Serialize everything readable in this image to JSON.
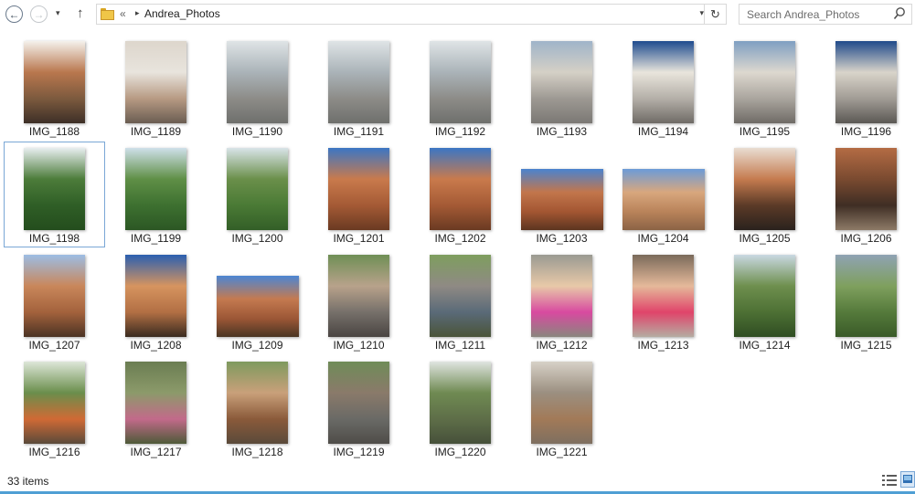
{
  "nav": {
    "back_glyph": "←",
    "forward_glyph": "→",
    "recent_glyph": "▾",
    "up_glyph": "↑"
  },
  "address": {
    "overflow_glyph": "«",
    "separator_glyph": "▸",
    "path": "Andrea_Photos",
    "dropdown_glyph": "▾",
    "refresh_glyph": "↻"
  },
  "search": {
    "placeholder": "Search Andrea_Photos"
  },
  "files": [
    {
      "name": "IMG_1188",
      "orientation": "portrait",
      "colors": [
        "#f4f1ec",
        "#b9774e",
        "#7c5a3e",
        "#3d2f27"
      ]
    },
    {
      "name": "IMG_1189",
      "orientation": "portrait",
      "colors": [
        "#ddd6cc",
        "#e8e4dd",
        "#b79a83",
        "#6a5d52"
      ]
    },
    {
      "name": "IMG_1190",
      "orientation": "portrait",
      "colors": [
        "#dfe4e6",
        "#aab3b8",
        "#8d8c88",
        "#6e6f6c"
      ]
    },
    {
      "name": "IMG_1191",
      "orientation": "portrait",
      "colors": [
        "#dfe4e6",
        "#aab3b8",
        "#8d8c88",
        "#6e6f6c"
      ]
    },
    {
      "name": "IMG_1192",
      "orientation": "portrait",
      "colors": [
        "#dfe4e6",
        "#aab3b8",
        "#8d8c88",
        "#6e6f6c"
      ]
    },
    {
      "name": "IMG_1193",
      "orientation": "portrait",
      "colors": [
        "#9fb4c9",
        "#d5d0c6",
        "#9d9993",
        "#7b7874"
      ]
    },
    {
      "name": "IMG_1194",
      "orientation": "portrait",
      "colors": [
        "#1e4b8f",
        "#e9e5dc",
        "#b4afa8",
        "#6f6b66"
      ]
    },
    {
      "name": "IMG_1195",
      "orientation": "portrait",
      "colors": [
        "#7f9fc2",
        "#ddd8cf",
        "#aaa59e",
        "#6f6b66"
      ]
    },
    {
      "name": "IMG_1196",
      "orientation": "portrait",
      "colors": [
        "#1f4a8a",
        "#d9d4ca",
        "#a19c95",
        "#5b5854"
      ]
    },
    {
      "name": "IMG_1198",
      "orientation": "portrait",
      "colors": [
        "#e8eef0",
        "#4c7c3a",
        "#2f5e26",
        "#244d1d"
      ]
    },
    {
      "name": "IMG_1199",
      "orientation": "portrait",
      "colors": [
        "#cfe0ea",
        "#5f8f46",
        "#3d7030",
        "#2c5724"
      ]
    },
    {
      "name": "IMG_1200",
      "orientation": "portrait",
      "colors": [
        "#d9e4e9",
        "#6a8f4a",
        "#4a7a35",
        "#335f27"
      ]
    },
    {
      "name": "IMG_1201",
      "orientation": "portrait",
      "colors": [
        "#3b76c4",
        "#c97a4c",
        "#a45a35",
        "#6a3a22"
      ]
    },
    {
      "name": "IMG_1202",
      "orientation": "portrait",
      "colors": [
        "#3b76c4",
        "#c97a4c",
        "#a45a35",
        "#6a3a22"
      ]
    },
    {
      "name": "IMG_1203",
      "orientation": "landscape",
      "colors": [
        "#4a83cf",
        "#c2764c",
        "#a35632",
        "#5c3520"
      ]
    },
    {
      "name": "IMG_1204",
      "orientation": "landscape",
      "colors": [
        "#6b9bd8",
        "#d8a77e",
        "#b9835a",
        "#8b6345"
      ]
    },
    {
      "name": "IMG_1205",
      "orientation": "portrait",
      "colors": [
        "#e9ddd2",
        "#c57b4f",
        "#5b3a27",
        "#2a221d"
      ]
    },
    {
      "name": "IMG_1206",
      "orientation": "portrait",
      "colors": [
        "#b46c44",
        "#7a4a30",
        "#3f2e24",
        "#8d7a67"
      ]
    },
    {
      "name": "IMG_1207",
      "orientation": "portrait",
      "colors": [
        "#9cbde4",
        "#c9875b",
        "#a3623c",
        "#4b3324"
      ]
    },
    {
      "name": "IMG_1208",
      "orientation": "portrait",
      "colors": [
        "#2a5fb0",
        "#d6945f",
        "#b26f44",
        "#3a2b20"
      ]
    },
    {
      "name": "IMG_1209",
      "orientation": "landscape",
      "colors": [
        "#4c86d3",
        "#c47a50",
        "#9c5736",
        "#4a3523"
      ]
    },
    {
      "name": "IMG_1210",
      "orientation": "portrait",
      "colors": [
        "#6f8f55",
        "#b8a28b",
        "#76706a",
        "#4a4542"
      ]
    },
    {
      "name": "IMG_1211",
      "orientation": "portrait",
      "colors": [
        "#7e9e5e",
        "#8f8a84",
        "#5a6a78",
        "#4a5438"
      ]
    },
    {
      "name": "IMG_1212",
      "orientation": "portrait",
      "colors": [
        "#9a9a92",
        "#e8c9a8",
        "#d84aa0",
        "#8a867e"
      ]
    },
    {
      "name": "IMG_1213",
      "orientation": "portrait",
      "colors": [
        "#7a6a5a",
        "#e5b99a",
        "#e0446a",
        "#b5aca1"
      ]
    },
    {
      "name": "IMG_1214",
      "orientation": "portrait",
      "colors": [
        "#c9d8e2",
        "#6e8f4e",
        "#4d7034",
        "#2f4d22"
      ]
    },
    {
      "name": "IMG_1215",
      "orientation": "portrait",
      "colors": [
        "#8fa2b3",
        "#7fa05e",
        "#557a3b",
        "#3a5a28"
      ]
    },
    {
      "name": "IMG_1216",
      "orientation": "portrait",
      "colors": [
        "#dde6d8",
        "#6a8e4c",
        "#d06a35",
        "#5a4a3a"
      ]
    },
    {
      "name": "IMG_1217",
      "orientation": "portrait",
      "colors": [
        "#6a7d52",
        "#8c9a6a",
        "#c26a8a",
        "#4e5a38"
      ]
    },
    {
      "name": "IMG_1218",
      "orientation": "portrait",
      "colors": [
        "#7e9a5e",
        "#c9a07a",
        "#8a5a3a",
        "#5a4a3a"
      ]
    },
    {
      "name": "IMG_1219",
      "orientation": "portrait",
      "colors": [
        "#6f8c58",
        "#8a7a6a",
        "#6a6a66",
        "#4f4c48"
      ]
    },
    {
      "name": "IMG_1220",
      "orientation": "portrait",
      "colors": [
        "#dfe4e0",
        "#6f8a52",
        "#5e6e48",
        "#46503a"
      ]
    },
    {
      "name": "IMG_1221",
      "orientation": "portrait",
      "colors": [
        "#d7d1c7",
        "#9b8f80",
        "#a27a58",
        "#7e6f60"
      ]
    }
  ],
  "selected_file": "IMG_1198",
  "status": {
    "count": "33 items"
  },
  "colors": {
    "accent": "#4f9fd4",
    "selection_border": "#7aa7d6"
  }
}
